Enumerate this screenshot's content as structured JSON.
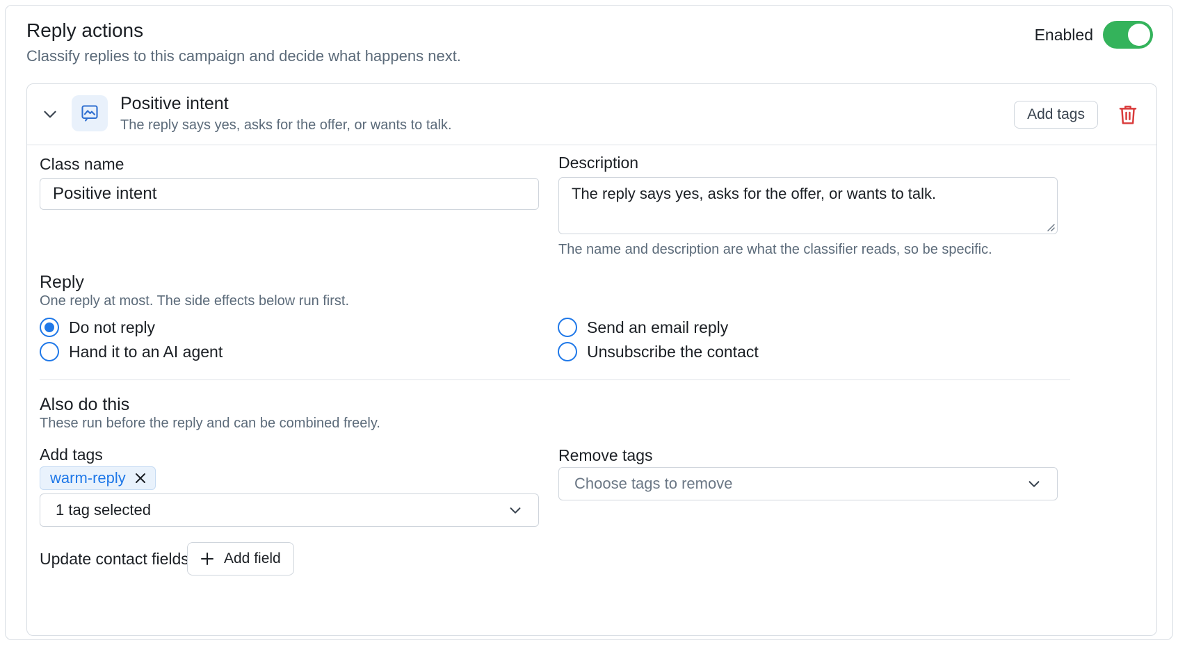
{
  "header": {
    "title": "Reply actions",
    "subtitle": "Classify replies to this campaign and decide what happens next.",
    "enabled_label": "Enabled",
    "enabled": true
  },
  "class_card": {
    "title": "Positive intent",
    "description": "The reply says yes, asks for the offer, or wants to talk.",
    "add_tags_button": "Add tags"
  },
  "form": {
    "class_name_label": "Class name",
    "class_name_value": "Positive intent",
    "description_label": "Description",
    "description_value": "The reply says yes, asks for the offer, or wants to talk.",
    "description_hint": "The name and description are what the classifier reads, so be specific."
  },
  "reply": {
    "title": "Reply",
    "subtitle": "One reply at most. The side effects below run first.",
    "options": [
      {
        "label": "Do not reply",
        "selected": true
      },
      {
        "label": "Hand it to an AI agent",
        "selected": false
      },
      {
        "label": "Send an email reply",
        "selected": false
      },
      {
        "label": "Unsubscribe the contact",
        "selected": false
      }
    ]
  },
  "also": {
    "title": "Also do this",
    "subtitle": "These run before the reply and can be combined freely.",
    "add_tags_label": "Add tags",
    "tags": [
      "warm-reply"
    ],
    "add_tags_select_value": "1 tag selected",
    "remove_tags_label": "Remove tags",
    "remove_tags_placeholder": "Choose tags to remove",
    "update_fields_label": "Update contact fields",
    "add_field_button": "Add field"
  },
  "colors": {
    "accent": "#1f78e8",
    "toggle_on": "#34b35b",
    "danger": "#d93a3a"
  }
}
